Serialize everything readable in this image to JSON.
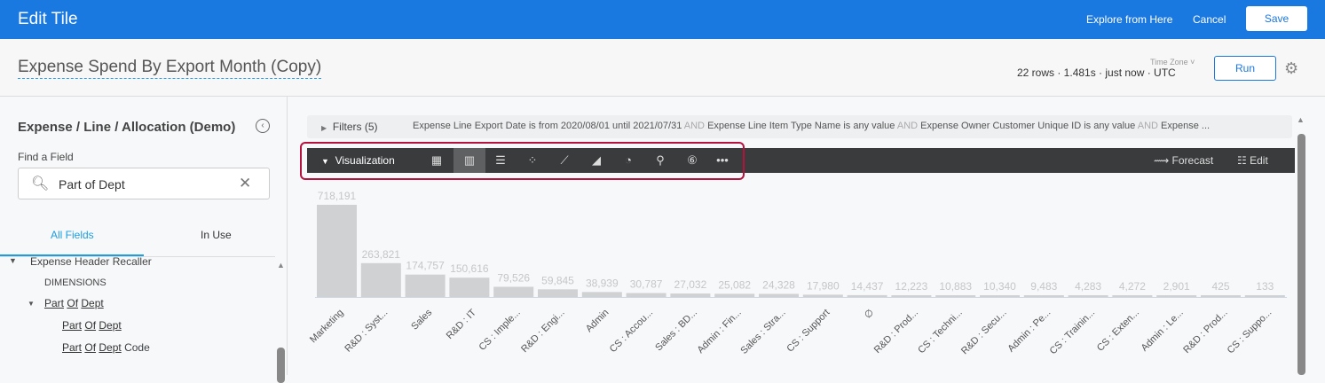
{
  "header": {
    "title": "Edit Tile",
    "explore": "Explore from Here",
    "cancel": "Cancel",
    "save": "Save"
  },
  "tile": {
    "title": "Expense Spend By Export Month (Copy)",
    "timezone_label": "Time Zone ˅",
    "meta": "22 rows · 1.481s · just now · UTC",
    "run": "Run"
  },
  "sidebar": {
    "model": "Expense / Line / Allocation (Demo)",
    "find_label": "Find a Field",
    "search_value": "Part of Dept",
    "tabs": [
      "All Fields",
      "In Use"
    ],
    "tree": {
      "view": "Expense Header Recaller",
      "section": "DIMENSIONS",
      "group": [
        "Part",
        "Of",
        "Dept"
      ],
      "fields": [
        {
          "words": [
            "Part",
            "Of",
            "Dept"
          ],
          "suffix": ""
        },
        {
          "words": [
            "Part",
            "Of",
            "Dept"
          ],
          "suffix": " Code"
        }
      ]
    }
  },
  "filters": {
    "label": "Filters (5)",
    "clauses": [
      "Expense Line Export Date is from 2020/08/01 until 2021/07/31",
      "Expense Line Item Type Name is any value",
      "Expense Owner Customer Unique ID is any value",
      "Expense ..."
    ],
    "joiner": "AND"
  },
  "visualization": {
    "label": "Visualization",
    "types": [
      "table",
      "column",
      "bar",
      "scatter",
      "line",
      "area",
      "pie",
      "map",
      "single-value",
      "more"
    ],
    "selected": "column",
    "forecast": "Forecast",
    "edit": "Edit"
  },
  "chart_data": {
    "type": "bar",
    "categories": [
      "Marketing",
      "R&D : Syst...",
      "Sales",
      "R&D : IT",
      "CS : Imple...",
      "R&D : Engi...",
      "Admin",
      "CS : Accou...",
      "Sales : BD...",
      "Admin : Fin...",
      "Sales : Stra...",
      "CS : Support",
      "∅",
      "R&D : Prod...",
      "CS : Techni...",
      "R&D : Secu...",
      "Admin : Pe...",
      "CS : Trainin...",
      "CS : Exten...",
      "Admin : Le...",
      "R&D : Prod...",
      "CS : Suppo..."
    ],
    "values": [
      718191,
      263821,
      174757,
      150616,
      79526,
      59845,
      38939,
      30787,
      27032,
      25082,
      24328,
      17980,
      14437,
      12223,
      10883,
      10340,
      9483,
      4283,
      4272,
      2901,
      425,
      133
    ],
    "value_labels": [
      "718,191",
      "263,821",
      "174,757",
      "150,616",
      "79,526",
      "59,845",
      "38,939",
      "30,787",
      "27,032",
      "25,082",
      "24,328",
      "17,980",
      "14,437",
      "12,223",
      "10,883",
      "10,340",
      "9,483",
      "4,283",
      "4,272",
      "2,901",
      "425",
      "133"
    ],
    "bar_color": "#cfd1d3",
    "data_labels": true,
    "grid": false
  }
}
